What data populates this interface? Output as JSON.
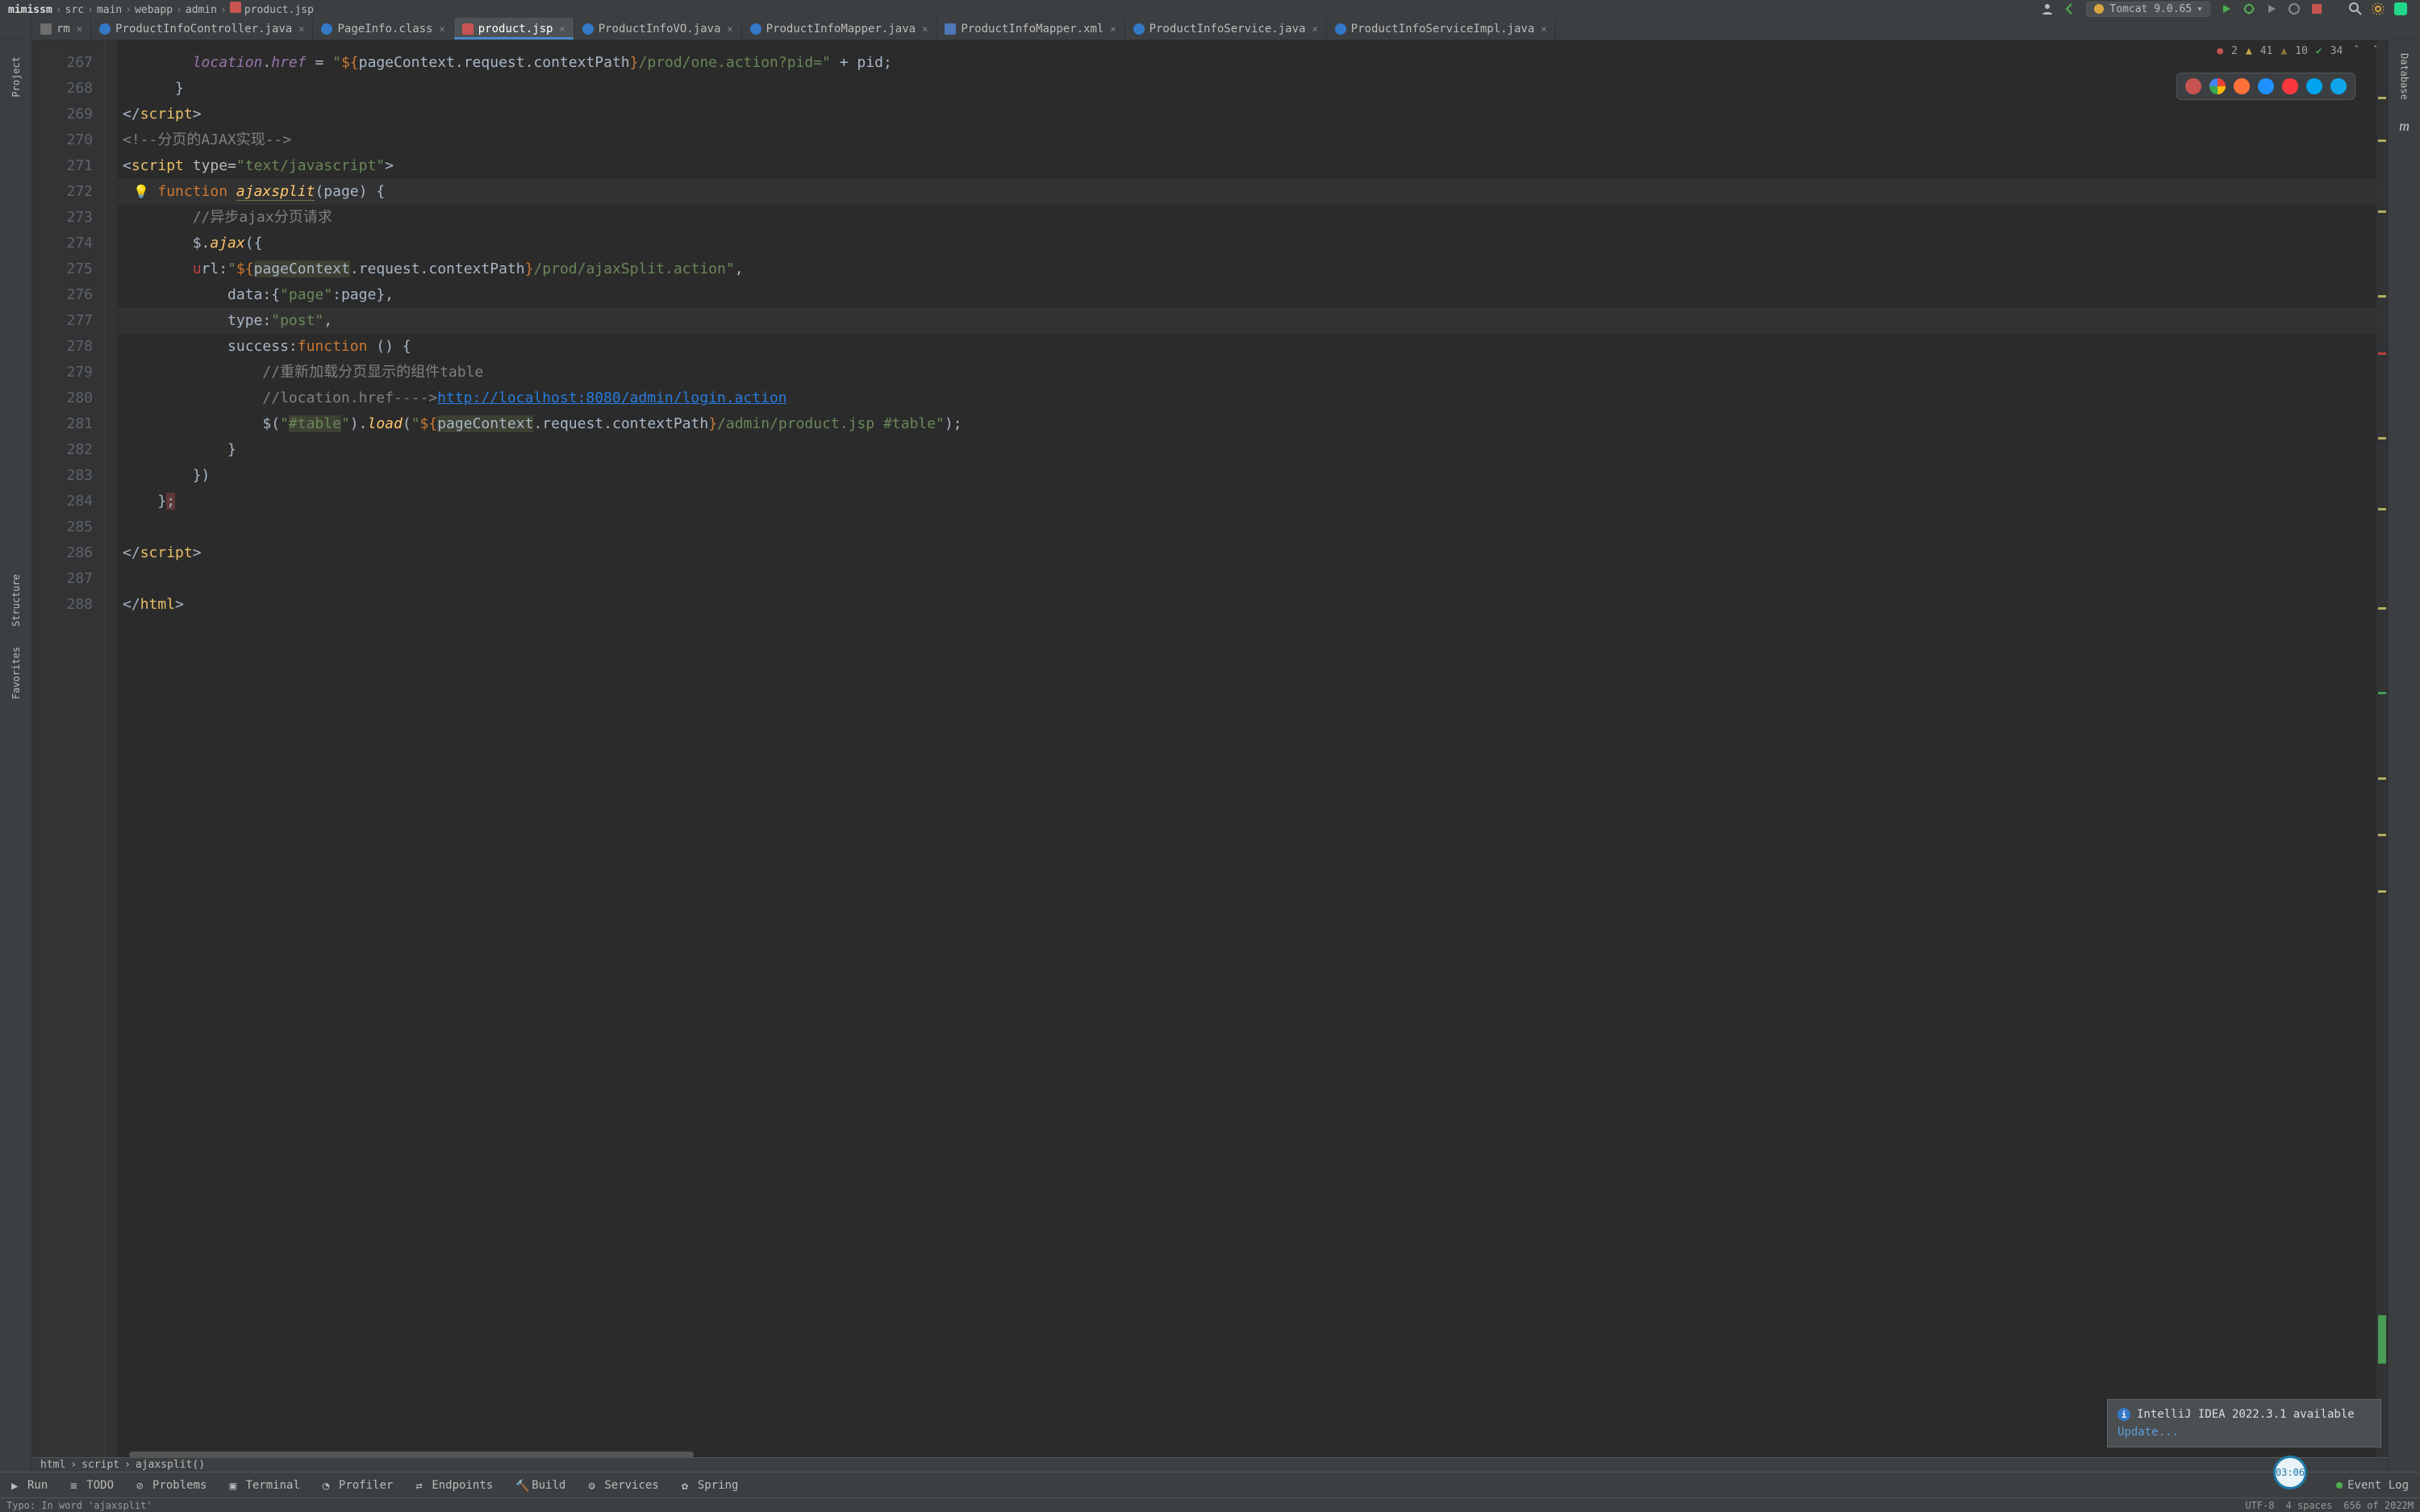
{
  "breadcrumbs": [
    "mimissm",
    "src",
    "main",
    "webapp",
    "admin",
    "product.jsp"
  ],
  "run_config": "Tomcat 9.0.65",
  "tabs": [
    {
      "label": "rm",
      "icon": "txt"
    },
    {
      "label": "ProductInfoController.java",
      "icon": "java"
    },
    {
      "label": "PageInfo.class",
      "icon": "cls"
    },
    {
      "label": "product.jsp",
      "icon": "jsp",
      "active": true
    },
    {
      "label": "ProductInfoVO.java",
      "icon": "java"
    },
    {
      "label": "ProductInfoMapper.java",
      "icon": "java"
    },
    {
      "label": "ProductInfoMapper.xml",
      "icon": "xml"
    },
    {
      "label": "ProductInfoService.java",
      "icon": "java"
    },
    {
      "label": "ProductInfoServiceImpl.java",
      "icon": "java"
    }
  ],
  "left_tools": [
    "Project",
    "Structure",
    "Favorites"
  ],
  "right_tools": [
    "Database",
    "Maven"
  ],
  "gutter_start": 267,
  "gutter_end": 288,
  "code_lines": [
    {
      "n": 267,
      "html": "        <span class='prop'>location</span>.<span class='prop'>href</span> = <span class='str'>\"</span><span class='el'>${</span><span class='ident'>pageContext</span>.<span class='ident'>request</span>.<span class='ident'>contextPath</span><span class='el'>}</span><span class='str'>/prod/one.action?pid=\"</span> + <span class='ident'>pid</span>;"
    },
    {
      "n": 268,
      "html": "      }"
    },
    {
      "n": 269,
      "html": "&lt;/<span class='tag'>script</span>&gt;"
    },
    {
      "n": 270,
      "html": "<span class='htmlcmt'>&lt;!--分页的AJAX实现--&gt;</span>"
    },
    {
      "n": 271,
      "html": "&lt;<span class='tag'>script </span><span class='attrname'>type=</span><span class='str'>\"text/javascript\"</span>&gt;"
    },
    {
      "n": 272,
      "html": "    <span class='bulb'>💡</span><span class='kw'>function</span> <span class='fn warn'>ajaxsplit</span>(<span class='ident'>page</span>) {",
      "caret": true
    },
    {
      "n": 273,
      "html": "        <span class='cmt'>//异步ajax分页请求</span>"
    },
    {
      "n": 274,
      "html": "        $.<span class='fn'>ajax</span>({"
    },
    {
      "n": 275,
      "html": "        <span class='err-dot'>u</span><span class='ident'>rl</span>:<span class='str'>\"</span><span class='el'>${</span><span class='ident usage'>pageContext</span>.<span class='ident'>request</span>.<span class='ident'>contextPath</span><span class='el'>}</span><span class='str'>/prod/ajaxSplit.action\"</span>,"
    },
    {
      "n": 276,
      "html": "            <span class='ident'>data</span>:{<span class='str'>\"page\"</span>:<span class='ident'>page</span>},"
    },
    {
      "n": 277,
      "html": "            <span class='ident'>type</span>:<span class='str'>\"post\"</span>,",
      "hl": true
    },
    {
      "n": 278,
      "html": "            <span class='ident'>success</span>:<span class='kw'>function</span> () {"
    },
    {
      "n": 279,
      "html": "                <span class='cmt'>//重新加载分页显示的组件table</span>"
    },
    {
      "n": 280,
      "html": "                <span class='cmt'>//location.href----&gt;</span><span class='link'>http://localhost:8080/admin/login.action</span>"
    },
    {
      "n": 281,
      "html": "                $(<span class='str'>\"<span class='usage'>#table</span>\"</span>).<span class='fn'>load</span>(<span class='str'>\"</span><span class='el'>${</span><span class='ident usage'>pageContext</span>.<span class='ident'>request</span>.<span class='ident'>contextPath</span><span class='el'>}</span><span class='str'>/admin/product.jsp #table\"</span>);"
    },
    {
      "n": 282,
      "html": "            }"
    },
    {
      "n": 283,
      "html": "        })"
    },
    {
      "n": 284,
      "html": "    }<span class='semi-err'>;</span>"
    },
    {
      "n": 285,
      "html": ""
    },
    {
      "n": 286,
      "html": "&lt;/<span class='tag'>script</span>&gt;"
    },
    {
      "n": 287,
      "html": ""
    },
    {
      "n": 288,
      "html": "&lt;/<span class='tag'>html</span>&gt;"
    }
  ],
  "inspections": {
    "errors": "2",
    "warnings": "41",
    "weak": "10",
    "typos": "34"
  },
  "editor_crumbs": [
    "html",
    "script",
    "ajaxsplit()"
  ],
  "bottom_tools": [
    "Run",
    "TODO",
    "Problems",
    "Terminal",
    "Profiler",
    "Endpoints",
    "Build",
    "Services",
    "Spring"
  ],
  "event_log": "Event Log",
  "status_msg": "Typo: In word 'ajaxsplit'",
  "status_right": {
    "encoding": "UTF-8",
    "indent": "4 spaces",
    "mem": "656 of 2022M"
  },
  "notification": {
    "title": "IntelliJ IDEA 2022.3.1 available",
    "action": "Update..."
  },
  "clock": "03:06"
}
